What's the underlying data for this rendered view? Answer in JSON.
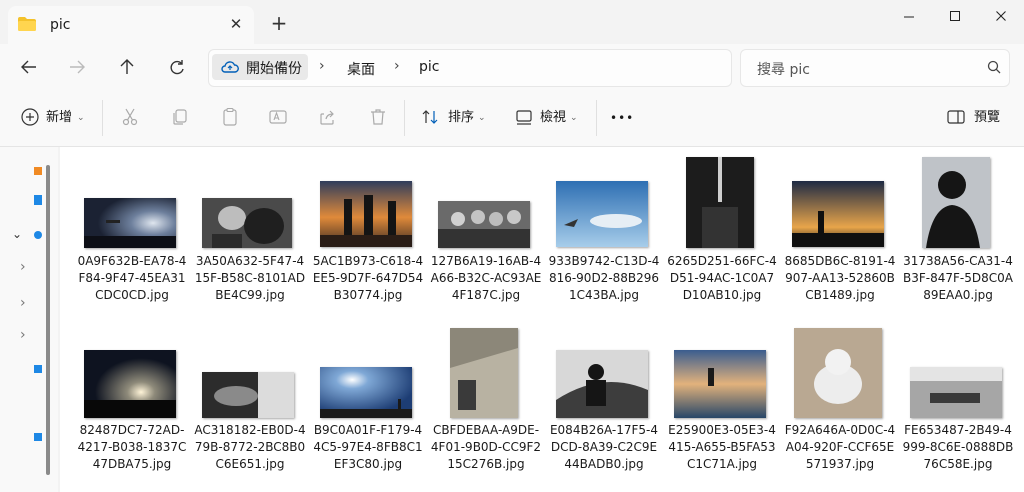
{
  "window": {
    "tab_title": "pic"
  },
  "address": {
    "home_label": "開始備份",
    "crumbs": [
      "桌面",
      "pic"
    ]
  },
  "search": {
    "placeholder": "搜尋 pic"
  },
  "toolbar": {
    "new_label": "新增",
    "sort_label": "排序",
    "view_label": "檢視",
    "more_label": "•••",
    "preview_label": "預覽"
  },
  "files": [
    {
      "name": "0A9F632B-EA78-4F84-9F47-45EA31CDC0CD.jpg"
    },
    {
      "name": "3A50A632-5F47-415F-B58C-8101ADBE4C99.jpg"
    },
    {
      "name": "5AC1B973-C618-4EE5-9D7F-647D54B30774.jpg"
    },
    {
      "name": "127B6A19-16AB-4A66-B32C-AC93AE4F187C.jpg"
    },
    {
      "name": "933B9742-C13D-4816-90D2-88B2961C43BA.jpg"
    },
    {
      "name": "6265D251-66FC-4D51-94AC-1C0A7D10AB10.jpg"
    },
    {
      "name": "8685DB6C-8191-4907-AA13-52860BCB1489.jpg"
    },
    {
      "name": "31738A56-CA31-4B3F-847F-5D8C0A89EAA0.jpg"
    },
    {
      "name": "82487DC7-72AD-4217-B038-1837C47DBA75.jpg"
    },
    {
      "name": "AC318182-EB0D-479B-8772-2BC8B0C6E651.jpg"
    },
    {
      "name": "B9C0A01F-F179-44C5-97E4-8FB8C1EF3C80.jpg"
    },
    {
      "name": "CBFDEBAA-A9DE-4F01-9B0D-CC9F215C276B.jpg"
    },
    {
      "name": "E084B26A-17F5-4DCD-8A39-C2C9E44BADB0.jpg"
    },
    {
      "name": "E25900E3-05E3-4415-A655-B5FA53C1C71A.jpg"
    },
    {
      "name": "F92A646A-0D0C-4A04-920F-CCF65E571937.jpg"
    },
    {
      "name": "FE653487-2B49-4999-8C6E-0888DB76C58E.jpg"
    }
  ],
  "colors": {
    "accent": "#005fb8",
    "folder": "#f4c22b"
  }
}
